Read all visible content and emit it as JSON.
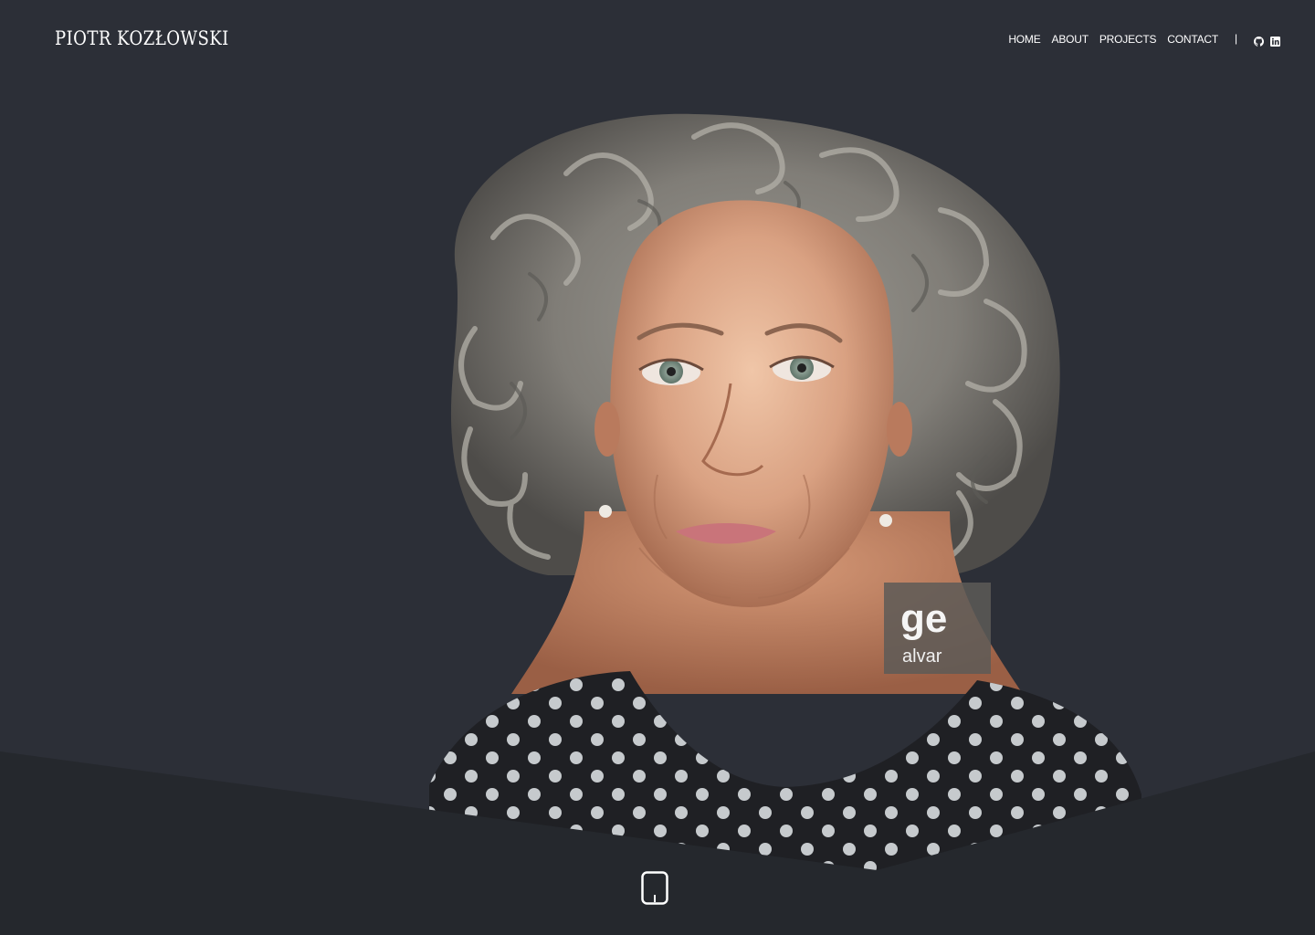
{
  "brand": {
    "name": "PIOTR KOZŁOWSKI"
  },
  "nav": {
    "items": [
      {
        "label": "HOME"
      },
      {
        "label": "ABOUT"
      },
      {
        "label": "PROJECTS"
      },
      {
        "label": "CONTACT"
      }
    ],
    "divider": "|"
  },
  "social": [
    {
      "icon": "github-icon"
    },
    {
      "icon": "linkedin-icon"
    }
  ],
  "hero": {
    "image": "portrait-photo",
    "watermark": {
      "line1": "ge",
      "line2": "alvar"
    }
  },
  "scroll": {
    "icon": "mouse-scroll-icon"
  },
  "colors": {
    "background": "#2c2f37",
    "band": "#25282d",
    "text": "#ffffff"
  }
}
